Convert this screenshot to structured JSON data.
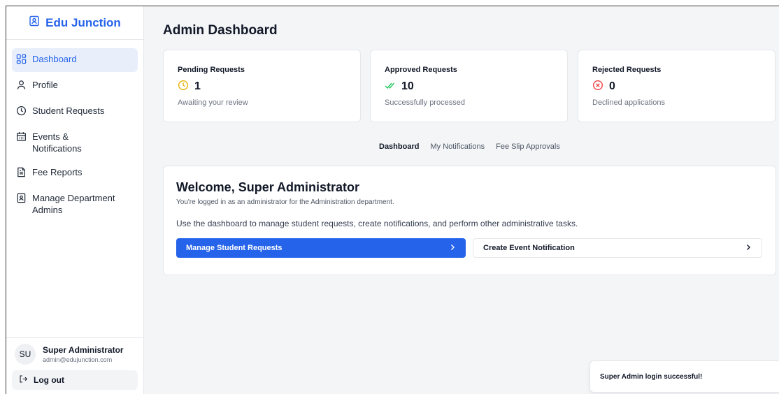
{
  "brand": {
    "name": "Edu Junction"
  },
  "sidebar": {
    "items": [
      {
        "label": "Dashboard",
        "icon": "dashboard-icon"
      },
      {
        "label": "Profile",
        "icon": "user-icon"
      },
      {
        "label": "Student Requests",
        "icon": "clock-icon"
      },
      {
        "label": "Events & Notifications",
        "icon": "calendar-icon"
      },
      {
        "label": "Fee Reports",
        "icon": "file-icon"
      },
      {
        "label": "Manage Department Admins",
        "icon": "id-card-icon"
      }
    ],
    "user": {
      "initials": "SU",
      "name": "Super Administrator",
      "email": "admin@edujunction.com"
    },
    "logout_label": "Log out"
  },
  "header": {
    "title": "Admin Dashboard"
  },
  "stats": [
    {
      "title": "Pending Requests",
      "value": "1",
      "subtitle": "Awaiting your review",
      "icon": "clock-icon",
      "color": "#eab308"
    },
    {
      "title": "Approved Requests",
      "value": "10",
      "subtitle": "Successfully processed",
      "icon": "check-double-icon",
      "color": "#22c55e"
    },
    {
      "title": "Rejected Requests",
      "value": "0",
      "subtitle": "Declined applications",
      "icon": "x-circle-icon",
      "color": "#ef4444"
    }
  ],
  "tabs": [
    "Dashboard",
    "My Notifications",
    "Fee Slip Approvals"
  ],
  "welcome": {
    "title": "Welcome, Super Administrator",
    "subtitle": "You're logged in as an administrator for the Administration department.",
    "description": "Use the dashboard to manage student requests, create notifications, and perform other administrative tasks.",
    "primary_action": "Manage Student Requests",
    "secondary_action": "Create Event Notification"
  },
  "toast": {
    "message": "Super Admin login successful!"
  },
  "colors": {
    "accent": "#2563eb"
  }
}
